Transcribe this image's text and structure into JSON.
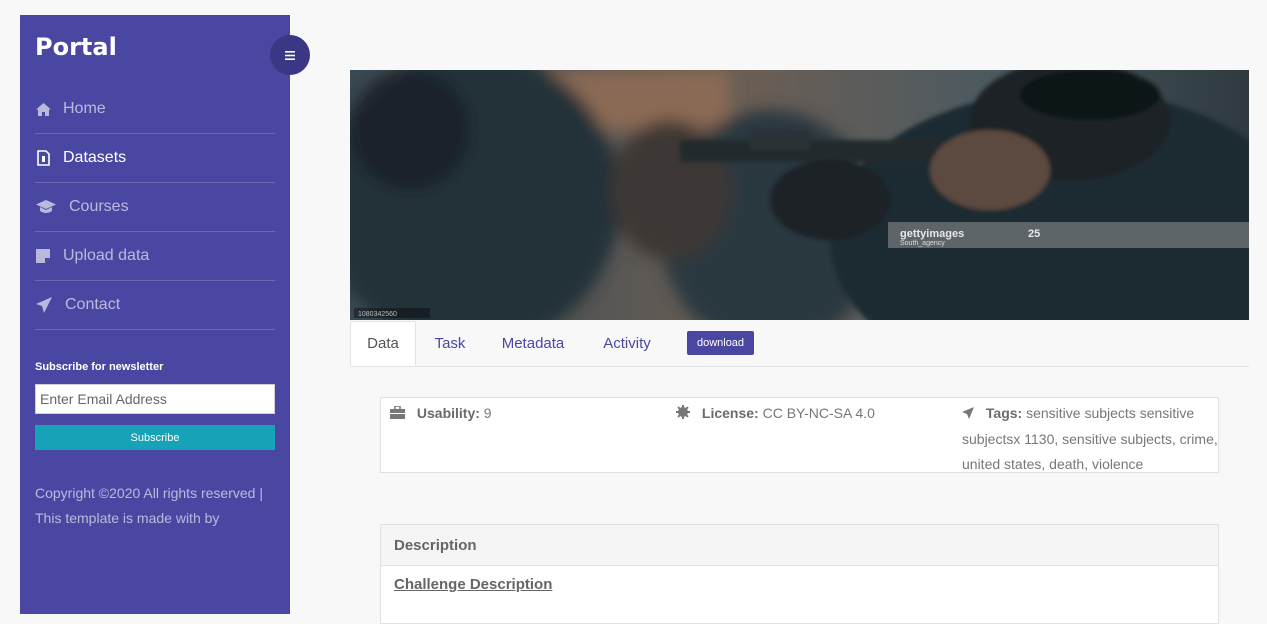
{
  "sidebar": {
    "brand": "Portal",
    "toggle_icon": "menu-icon",
    "items": [
      {
        "label": "Home",
        "icon": "home-icon",
        "active": false
      },
      {
        "label": "Datasets",
        "icon": "dataset-icon",
        "active": true
      },
      {
        "label": "Courses",
        "icon": "graduation-cap-icon",
        "active": false
      },
      {
        "label": "Upload data",
        "icon": "sticky-note-icon",
        "active": false
      },
      {
        "label": "Contact",
        "icon": "paper-plane-icon",
        "active": false
      }
    ],
    "newsletter": {
      "title": "Subscribe for newsletter",
      "placeholder": "Enter Email Address",
      "button": "Subscribe"
    },
    "copyright": "Copyright ©2020 All rights reserved | This template is made with by"
  },
  "banner": {
    "watermark": "gettyimages",
    "watermark_badge": "25",
    "credit": "South_agency",
    "image_id": "1080342560"
  },
  "tabs": {
    "items": [
      "Data",
      "Task",
      "Metadata",
      "Activity"
    ],
    "active": "Data",
    "download_label": "download"
  },
  "stats": {
    "usability_label": "Usability:",
    "usability_value": "9",
    "license_label": "License:",
    "license_value": "CC BY-NC-SA 4.0",
    "tags_label": "Tags:",
    "tags_value": "sensitive subjects sensitive subjectsx 1130, sensitive subjects, crime, united states, death, violence"
  },
  "description": {
    "heading": "Description",
    "subheading": "Challenge Description"
  },
  "colors": {
    "sidebar": "#4a47a3",
    "accent": "#4a47a3",
    "subscribe": "#17a2b8"
  }
}
